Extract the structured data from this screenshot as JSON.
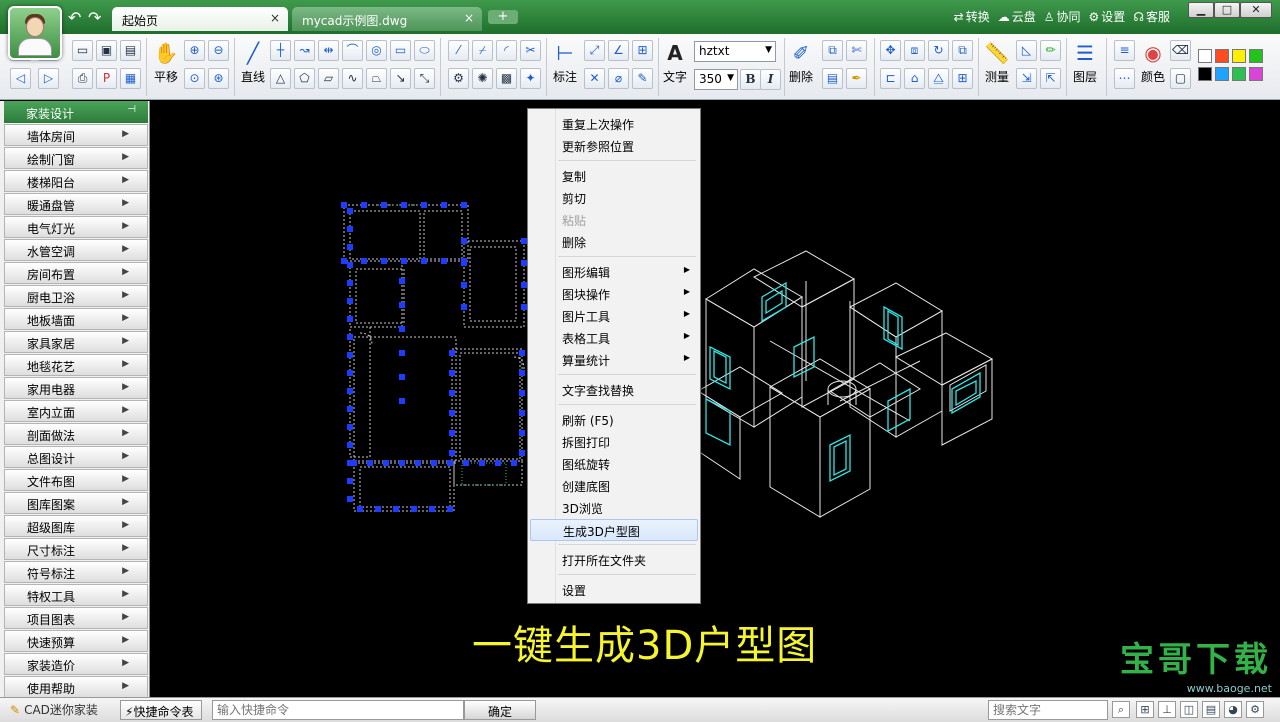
{
  "titlebar": {
    "tabs": [
      {
        "label": "起始页",
        "close": "×"
      },
      {
        "label": "mycad示例图.dwg",
        "close": "×"
      }
    ],
    "add_tab": "+",
    "menu": [
      "转换",
      "云盘",
      "协同",
      "设置",
      "客服"
    ],
    "window_buttons": [
      "▁",
      "□",
      "✕"
    ]
  },
  "ribbon": {
    "labels": {
      "pan": "平移",
      "line": "直线",
      "dimension": "标注",
      "text": "文字",
      "delete": "删除",
      "measure": "测量",
      "layer": "图层",
      "color": "颜色"
    },
    "font_name": "hztxt",
    "font_size": "350",
    "bold": "B",
    "italic": "I",
    "colors": [
      "#ffffff",
      "#ff4b1f",
      "#ffef00",
      "#22c41c",
      "#000000",
      "#1fa3ff",
      "#2dbf52",
      "#d845d8"
    ]
  },
  "leftpanel": {
    "header": "家装设计",
    "items": [
      "墙体房间",
      "绘制门窗",
      "楼梯阳台",
      "暖通盘管",
      "电气灯光",
      "水管空调",
      "房间布置",
      "厨电卫浴",
      "地板墙面",
      "家具家居",
      "地毯花艺",
      "家用电器",
      "室内立面",
      "剖面做法",
      "总图设计",
      "文件布图",
      "图库图案",
      "超级图库",
      "尺寸标注",
      "符号标注",
      "特权工具",
      "项目图表",
      "快速预算",
      "家装造价",
      "使用帮助"
    ]
  },
  "context_menu": {
    "groups": [
      [
        {
          "label": "重复上次操作"
        },
        {
          "label": "更新参照位置"
        }
      ],
      [
        {
          "label": "复制"
        },
        {
          "label": "剪切"
        },
        {
          "label": "粘贴",
          "disabled": true
        },
        {
          "label": "删除"
        }
      ],
      [
        {
          "label": "图形编辑",
          "submenu": true
        },
        {
          "label": "图块操作",
          "submenu": true
        },
        {
          "label": "图片工具",
          "submenu": true
        },
        {
          "label": "表格工具",
          "submenu": true
        },
        {
          "label": "算量统计",
          "submenu": true
        }
      ],
      [
        {
          "label": "文字查找替换"
        }
      ],
      [
        {
          "label": "刷新 (F5)"
        },
        {
          "label": "拆图打印"
        },
        {
          "label": "图纸旋转"
        },
        {
          "label": "创建底图"
        },
        {
          "label": "3D浏览"
        },
        {
          "label": "生成3D户型图",
          "highlighted": true
        }
      ],
      [
        {
          "label": "打开所在文件夹"
        }
      ],
      [
        {
          "label": "设置"
        }
      ]
    ]
  },
  "canvas": {
    "caption": "一键生成3D户型图",
    "watermark": "宝哥下载",
    "watermark_url": "www.baoge.net"
  },
  "statusbar": {
    "brand": "CAD迷你家装",
    "cmd_table": "快捷命令表",
    "cmd_placeholder": "输入快捷命令",
    "ok": "确定",
    "search_placeholder": "搜索文字"
  }
}
